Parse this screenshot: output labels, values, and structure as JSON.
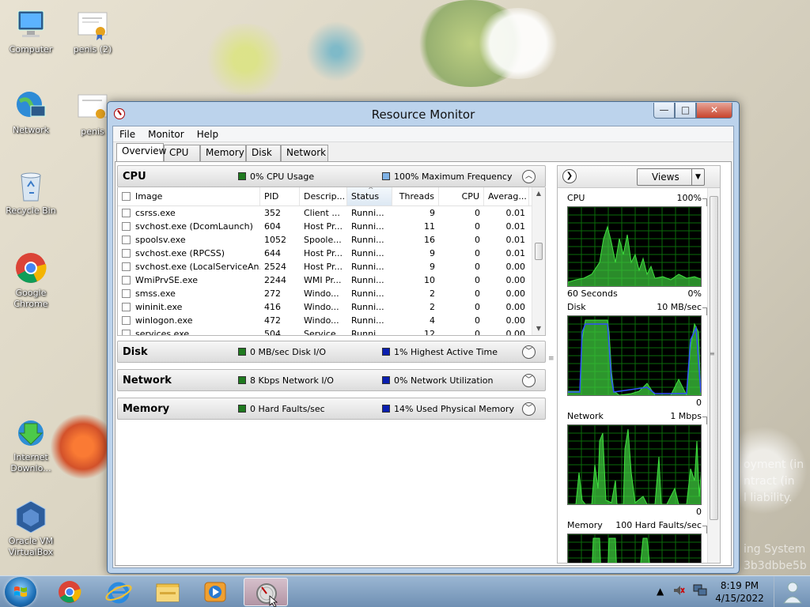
{
  "desktop": {
    "icons": [
      {
        "label": "Computer"
      },
      {
        "label": "penis (2)"
      },
      {
        "label": "Network"
      },
      {
        "label": "penis"
      },
      {
        "label": "Recycle Bin"
      },
      {
        "label": "Google Chrome"
      },
      {
        "label": "Internet Downlo..."
      },
      {
        "label": "Oracle VM VirtualBox"
      }
    ],
    "wallpaper_text": [
      "oyment (in",
      "ntract (in",
      "l liability.",
      "ing System",
      "3b3dbbe5b"
    ]
  },
  "window": {
    "title": "Resource Monitor",
    "controls": {
      "minimize": "—",
      "maximize": "□",
      "close": "✕"
    },
    "menu": [
      "File",
      "Monitor",
      "Help"
    ],
    "tabs": [
      "Overview",
      "CPU",
      "Memory",
      "Disk",
      "Network"
    ],
    "active_tab": "Overview"
  },
  "cpu_section": {
    "name": "CPU",
    "indicator1": "0% CPU Usage",
    "indicator1_color": "#1f7a1f",
    "indicator2": "100% Maximum Frequency",
    "indicator2_color": "#7fb2e6",
    "columns": [
      "Image",
      "PID",
      "Descrip...",
      "Status",
      "Threads",
      "CPU",
      "Averag..."
    ],
    "rows": [
      {
        "image": "csrss.exe",
        "pid": "352",
        "desc": "Client ...",
        "status": "Runni...",
        "threads": "9",
        "cpu": "0",
        "avg": "0.01"
      },
      {
        "image": "svchost.exe (DcomLaunch)",
        "pid": "604",
        "desc": "Host Pr...",
        "status": "Runni...",
        "threads": "11",
        "cpu": "0",
        "avg": "0.01"
      },
      {
        "image": "spoolsv.exe",
        "pid": "1052",
        "desc": "Spoole...",
        "status": "Runni...",
        "threads": "16",
        "cpu": "0",
        "avg": "0.01"
      },
      {
        "image": "svchost.exe (RPCSS)",
        "pid": "644",
        "desc": "Host Pr...",
        "status": "Runni...",
        "threads": "9",
        "cpu": "0",
        "avg": "0.01"
      },
      {
        "image": "svchost.exe (LocalServiceAn...",
        "pid": "2524",
        "desc": "Host Pr...",
        "status": "Runni...",
        "threads": "9",
        "cpu": "0",
        "avg": "0.00"
      },
      {
        "image": "WmiPrvSE.exe",
        "pid": "2244",
        "desc": "WMI Pr...",
        "status": "Runni...",
        "threads": "10",
        "cpu": "0",
        "avg": "0.00"
      },
      {
        "image": "smss.exe",
        "pid": "272",
        "desc": "Windo...",
        "status": "Runni...",
        "threads": "2",
        "cpu": "0",
        "avg": "0.00"
      },
      {
        "image": "wininit.exe",
        "pid": "416",
        "desc": "Windo...",
        "status": "Runni...",
        "threads": "2",
        "cpu": "0",
        "avg": "0.00"
      },
      {
        "image": "winlogon.exe",
        "pid": "472",
        "desc": "Windo...",
        "status": "Runni...",
        "threads": "4",
        "cpu": "0",
        "avg": "0.00"
      },
      {
        "image": "services.exe",
        "pid": "504",
        "desc": "Service...",
        "status": "Runni...",
        "threads": "12",
        "cpu": "0",
        "avg": "0.00"
      }
    ]
  },
  "disk_section": {
    "name": "Disk",
    "indicator1": "0 MB/sec Disk I/O",
    "indicator1_color": "#1f7a1f",
    "indicator2": "1% Highest Active Time",
    "indicator2_color": "#0b1fb0"
  },
  "network_section": {
    "name": "Network",
    "indicator1": "8 Kbps Network I/O",
    "indicator1_color": "#1f7a1f",
    "indicator2": "0% Network Utilization",
    "indicator2_color": "#0b1fb0"
  },
  "memory_section": {
    "name": "Memory",
    "indicator1": "0 Hard Faults/sec",
    "indicator1_color": "#1f7a1f",
    "indicator2": "14% Used Physical Memory",
    "indicator2_color": "#0b1fb0"
  },
  "graphs": {
    "views_label": "Views",
    "cpu": {
      "label": "CPU",
      "max": "100%",
      "footer_left": "60 Seconds",
      "footer_right": "0%"
    },
    "disk": {
      "label": "Disk",
      "max": "10 MB/sec",
      "footer_right": "0"
    },
    "network": {
      "label": "Network",
      "max": "1 Mbps",
      "footer_right": "0"
    },
    "memory": {
      "label": "Memory",
      "max": "100 Hard Faults/sec"
    }
  },
  "taskbar": {
    "time": "8:19 PM",
    "date": "4/15/2022"
  }
}
